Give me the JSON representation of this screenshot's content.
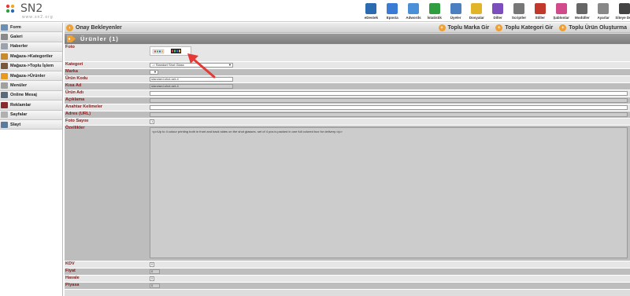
{
  "logo": {
    "name": "SN2",
    "sub": "www.sn2.org"
  },
  "toolbar": [
    {
      "label": "eDestek",
      "icon": "support-icon",
      "color": "#2b6cb0"
    },
    {
      "label": "Eposta",
      "icon": "mail-icon",
      "color": "#3a7bd5"
    },
    {
      "label": "Adwords",
      "icon": "adwords-icon",
      "color": "#4a90d9"
    },
    {
      "label": "İstatistik",
      "icon": "stats-icon",
      "color": "#2e9e3e"
    },
    {
      "label": "Üyeler",
      "icon": "users-icon",
      "color": "#4a7fc1"
    },
    {
      "label": "Dosyalar",
      "icon": "folder-icon",
      "color": "#e2b428"
    },
    {
      "label": "Diller",
      "icon": "language-icon",
      "color": "#7c4dbd"
    },
    {
      "label": "Scriptler",
      "icon": "scripts-icon",
      "color": "#777777"
    },
    {
      "label": "Stiller",
      "icon": "styles-icon",
      "color": "#c0392b"
    },
    {
      "label": "Şablonlar",
      "icon": "templates-icon",
      "color": "#d04a8c"
    },
    {
      "label": "Modüller",
      "icon": "modules-icon",
      "color": "#666666"
    },
    {
      "label": "Ayarlar",
      "icon": "settings-icon",
      "color": "#888888"
    },
    {
      "label": "Siteye Dön",
      "icon": "back-to-site-icon",
      "color": "#444444"
    }
  ],
  "sidebar": [
    {
      "label": "Form",
      "icon": "form-icon",
      "color": "#6b8fb3"
    },
    {
      "label": "Galeri",
      "icon": "gallery-icon",
      "color": "#8a8a8a"
    },
    {
      "label": "Haberler",
      "icon": "news-icon",
      "color": "#9aa3ad"
    },
    {
      "label": "Mağaza->Kategoriler",
      "icon": "category-icon",
      "color": "#c98b2a"
    },
    {
      "label": "Mağaza->Toplu İşlem",
      "icon": "bulk-icon",
      "color": "#7a5a3a"
    },
    {
      "label": "Mağaza->Ürünler",
      "icon": "products-icon",
      "color": "#e89a1e"
    },
    {
      "label": "Menüler",
      "icon": "menu-icon",
      "color": "#a0a0a0"
    },
    {
      "label": "Online Mesaj",
      "icon": "message-icon",
      "color": "#5a6a7a"
    },
    {
      "label": "Reklamlar",
      "icon": "ads-icon",
      "color": "#8b2a2a"
    },
    {
      "label": "Sayfalar",
      "icon": "pages-icon",
      "color": "#b0b0b0"
    },
    {
      "label": "Slayt",
      "icon": "slide-icon",
      "color": "#5a7aa0"
    }
  ],
  "header": {
    "title": "Onay Bekleyenler",
    "actions": [
      "Toplu Marka Gir",
      "Toplu Kategori Gir",
      "Toplu Ürün Oluşturma"
    ]
  },
  "section": {
    "title": "Ürünler (1)"
  },
  "form": {
    "foto": "Foto",
    "kategori": "Kategori",
    "kategori_value": "-> Standart Shot Glass",
    "marka": "Marka",
    "urun_kodu": "Ürün Kodu",
    "urun_kodu_value": "standard-shot-set-4",
    "kisa_ad": "Kısa Ad",
    "kisa_ad_value": "standard-shot-set-4",
    "urun_adi": "Ürün Adı",
    "aciklama": "Açıklama",
    "anahtar": "Anahtar Kelimeler",
    "adres": "Adres (URL)",
    "foto_sayisi": "Foto Sayısı",
    "foto_sayisi_value": "1",
    "ozellikler": "Özellikler",
    "ozellikler_value": "<p>Up to 4 colour printing both in front and back sides on the shot glasses. set of 4 pcs is packed in one full colored box for delivery.</p>",
    "kdv": "KDV",
    "kdv_value": "0",
    "fiyat": "Fiyat",
    "fiyat_value": "0",
    "havale": "Havale",
    "havale_value": "0",
    "piyasa": "Piyasa",
    "piyasa_value": "0"
  }
}
